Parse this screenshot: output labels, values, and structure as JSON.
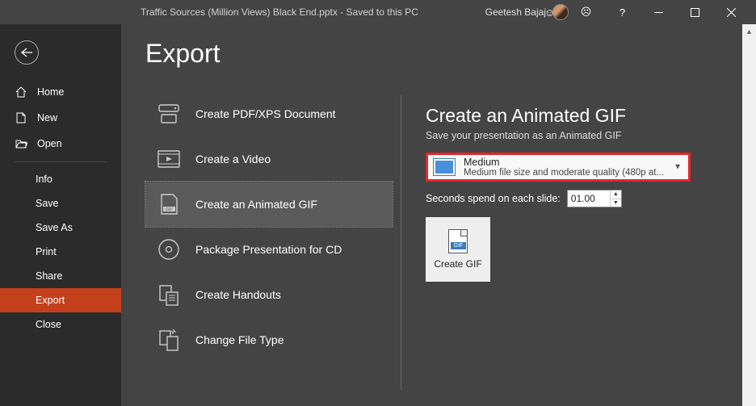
{
  "titlebar": {
    "title": "Traffic Sources (Million Views) Black End.pptx - Saved to this PC",
    "user": "Geetesh Bajaj",
    "help": "?"
  },
  "nav": {
    "home": "Home",
    "new": "New",
    "open": "Open",
    "info": "Info",
    "save": "Save",
    "saveas": "Save As",
    "print": "Print",
    "share": "Share",
    "export": "Export",
    "close": "Close"
  },
  "export": {
    "title": "Export",
    "items": {
      "pdf": "Create PDF/XPS Document",
      "video": "Create a Video",
      "gif": "Create an Animated GIF",
      "package": "Package Presentation for CD",
      "handouts": "Create Handouts",
      "filetype": "Change File Type"
    }
  },
  "right": {
    "title": "Create an Animated GIF",
    "sub": "Save your presentation as an Animated GIF",
    "quality_label": "Medium",
    "quality_desc": "Medium file size and moderate quality (480p at...",
    "seconds_label": "Seconds spend on each slide:",
    "seconds_value": "01.00",
    "create_btn": "Create GIF",
    "gif_badge": "GIF"
  }
}
